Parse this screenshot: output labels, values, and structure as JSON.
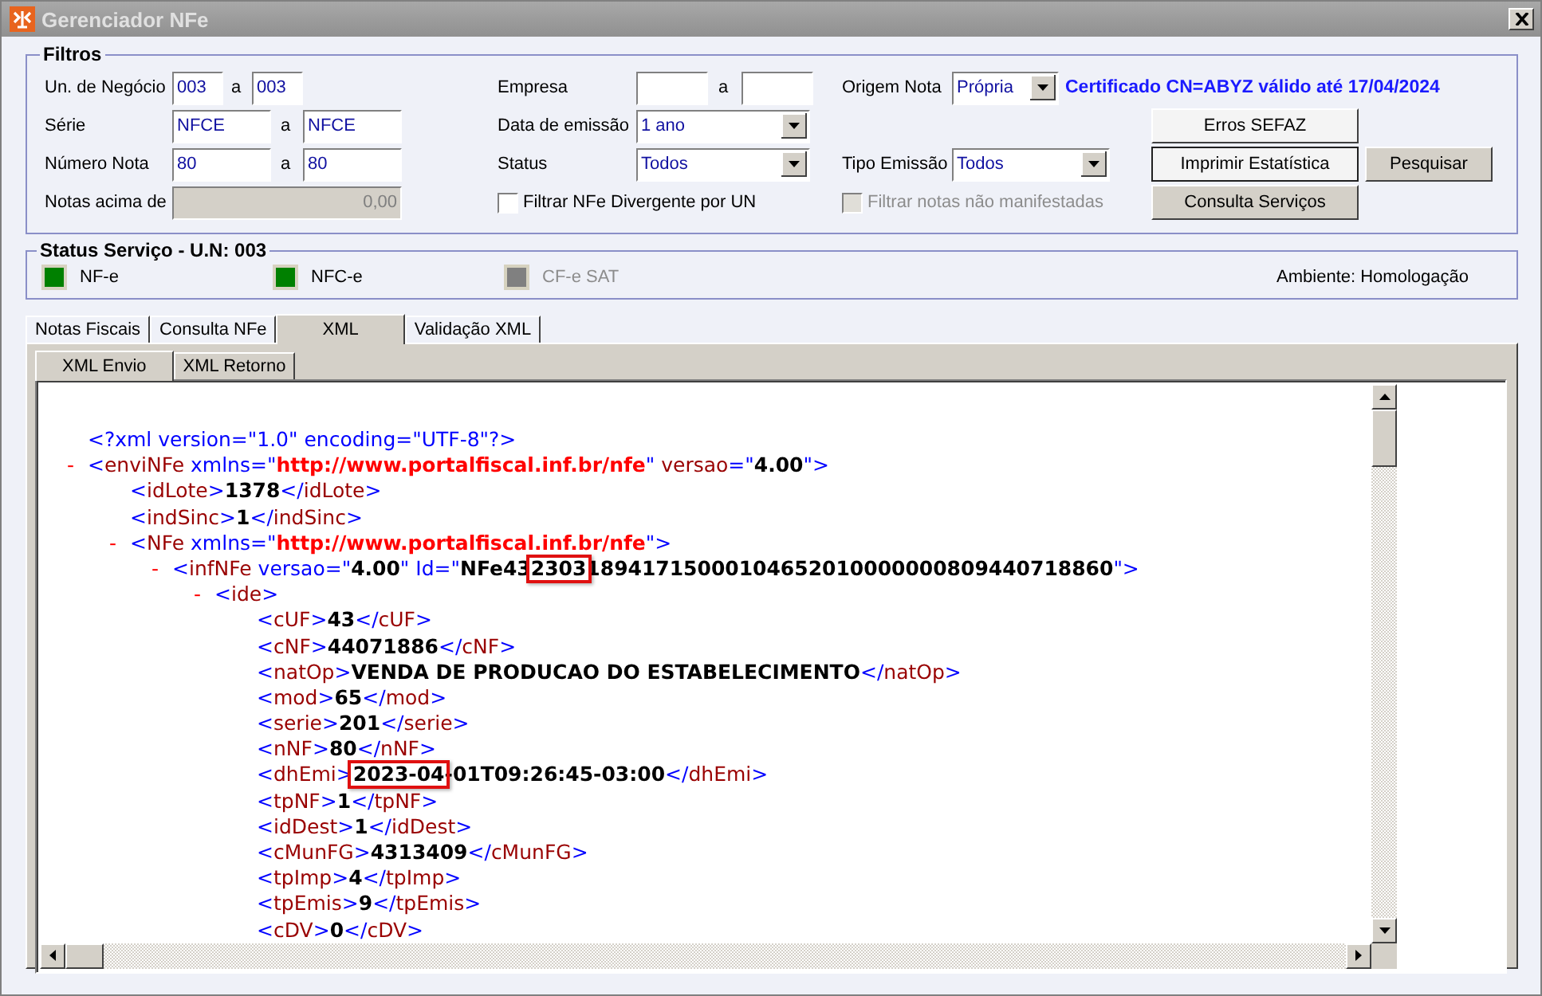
{
  "window": {
    "title": "Gerenciador NFe"
  },
  "filters": {
    "legend": "Filtros",
    "rows": [
      [
        {
          "kind": "range",
          "label": "Un. de Negócio",
          "from": "003",
          "sep": "a",
          "to": "003"
        },
        {
          "kind": "range",
          "label": "Empresa",
          "sep": "a"
        },
        {
          "kind": "select",
          "label": "Origem Nota",
          "value": "Própria",
          "note": "Certificado CN=ABYZ válido até 17/04/2024"
        }
      ],
      [
        {
          "kind": "range",
          "label": "Série",
          "from": "NFCE",
          "sep": "a",
          "to": "NFCE"
        },
        {
          "kind": "select",
          "label": "Data de emissão",
          "value": "1 ano"
        }
      ],
      [
        {
          "kind": "range",
          "label": "Número Nota",
          "from": "80",
          "sep": "a",
          "to": "80"
        },
        {
          "kind": "select",
          "label": "Status",
          "value": "Todos"
        },
        {
          "kind": "select",
          "label": "Tipo Emissão",
          "value": "Todos"
        }
      ],
      [
        {
          "kind": "input",
          "label": "Notas acima de",
          "value": "0,00",
          "disabled": true
        },
        {
          "kind": "checkbox",
          "label": "Filtrar NFe Divergente por UN",
          "checked": false,
          "disabled": false
        },
        {
          "kind": "checkbox",
          "label": "Filtrar notas não manifestadas",
          "checked": false,
          "disabled": true
        }
      ]
    ],
    "buttons": [
      {
        "label": "Erros SEFAZ",
        "highlighted": true
      },
      {
        "label": "Imprimir Estatística",
        "highlighted": true
      },
      {
        "label": "Consulta Serviços",
        "highlighted": false
      },
      {
        "label": "Pesquisar",
        "highlighted": false
      }
    ]
  },
  "status": {
    "legend": "Status Serviço - U.N: 003",
    "items": [
      {
        "label": "NF-e",
        "color": "#008000",
        "enabled": true
      },
      {
        "label": "NFC-e",
        "color": "#008000",
        "enabled": true
      },
      {
        "label": "CF-e SAT",
        "color": "#808080",
        "enabled": false
      }
    ],
    "environment": "Ambiente: Homologação"
  },
  "tabs": [
    {
      "label": "Notas Fiscais",
      "selected": false
    },
    {
      "label": "Consulta NFe",
      "selected": false
    },
    {
      "label": "XML",
      "selected": true
    },
    {
      "label": "Validação XML",
      "selected": false
    }
  ],
  "subtabs": [
    {
      "label": "XML Envio",
      "selected": true
    },
    {
      "label": "XML Retorno",
      "selected": false
    }
  ],
  "xml": [
    {
      "segs": [
        {
          "kind": "punct",
          "text": "<?xml version=\"1.0\" encoding=\"UTF-8\"?>"
        }
      ]
    },
    {
      "toggle": "-",
      "expanded": true,
      "segs": [
        {
          "kind": "punct",
          "text": "<"
        },
        {
          "kind": "tag",
          "text": "enviNFe"
        },
        {
          "kind": "punct",
          "text": " xmlns=\""
        },
        {
          "kind": "url",
          "text": "http://www.portalfiscal.inf.br/nfe"
        },
        {
          "kind": "punct",
          "text": "\""
        },
        {
          "kind": "attr",
          "text": " versao"
        },
        {
          "kind": "punct",
          "text": "=\""
        },
        {
          "kind": "value",
          "text": "4.00"
        },
        {
          "kind": "punct",
          "text": "\">"
        }
      ],
      "children": [
        {
          "segs": [
            {
              "kind": "punct",
              "text": "<"
            },
            {
              "kind": "tag",
              "text": "idLote"
            },
            {
              "kind": "punct",
              "text": ">"
            },
            {
              "kind": "value",
              "text": "1378"
            },
            {
              "kind": "punct",
              "text": "</"
            },
            {
              "kind": "tag",
              "text": "idLote"
            },
            {
              "kind": "punct",
              "text": ">"
            }
          ]
        },
        {
          "segs": [
            {
              "kind": "punct",
              "text": "<"
            },
            {
              "kind": "tag",
              "text": "indSinc"
            },
            {
              "kind": "punct",
              "text": ">"
            },
            {
              "kind": "value",
              "text": "1"
            },
            {
              "kind": "punct",
              "text": "</"
            },
            {
              "kind": "tag",
              "text": "indSinc"
            },
            {
              "kind": "punct",
              "text": ">"
            }
          ]
        },
        {
          "toggle": "-",
          "expanded": true,
          "segs": [
            {
              "kind": "punct",
              "text": "<"
            },
            {
              "kind": "tag",
              "text": "NFe"
            },
            {
              "kind": "punct",
              "text": " xmlns=\""
            },
            {
              "kind": "url",
              "text": "http://www.portalfiscal.inf.br/nfe"
            },
            {
              "kind": "punct",
              "text": "\">"
            }
          ],
          "children": [
            {
              "toggle": "-",
              "expanded": true,
              "segs": [
                {
                  "kind": "punct",
                  "text": "<"
                },
                {
                  "kind": "tag",
                  "text": "infNFe"
                },
                {
                  "kind": "punct",
                  "text": " versao=\""
                },
                {
                  "kind": "value",
                  "text": "4.00"
                },
                {
                  "kind": "punct",
                  "text": "\" Id=\""
                },
                {
                  "kind": "value",
                  "text": "NFe43"
                },
                {
                  "kind": "mark",
                  "text": "2303"
                },
                {
                  "kind": "value",
                  "text": "18941715000104652010000000809440718860"
                },
                {
                  "kind": "punct",
                  "text": "\">"
                }
              ],
              "children": [
                {
                  "toggle": "-",
                  "expanded": true,
                  "segs": [
                    {
                      "kind": "punct",
                      "text": "<"
                    },
                    {
                      "kind": "tag",
                      "text": "ide"
                    },
                    {
                      "kind": "punct",
                      "text": ">"
                    }
                  ],
                  "children": [
                    {
                      "segs": [
                        {
                          "kind": "punct",
                          "text": "<"
                        },
                        {
                          "kind": "tag",
                          "text": "cUF"
                        },
                        {
                          "kind": "punct",
                          "text": ">"
                        },
                        {
                          "kind": "value",
                          "text": "43"
                        },
                        {
                          "kind": "punct",
                          "text": "</"
                        },
                        {
                          "kind": "tag",
                          "text": "cUF"
                        },
                        {
                          "kind": "punct",
                          "text": ">"
                        }
                      ]
                    },
                    {
                      "segs": [
                        {
                          "kind": "punct",
                          "text": "<"
                        },
                        {
                          "kind": "tag",
                          "text": "cNF"
                        },
                        {
                          "kind": "punct",
                          "text": ">"
                        },
                        {
                          "kind": "value",
                          "text": "44071886"
                        },
                        {
                          "kind": "punct",
                          "text": "</"
                        },
                        {
                          "kind": "tag",
                          "text": "cNF"
                        },
                        {
                          "kind": "punct",
                          "text": ">"
                        }
                      ]
                    },
                    {
                      "segs": [
                        {
                          "kind": "punct",
                          "text": "<"
                        },
                        {
                          "kind": "tag",
                          "text": "natOp"
                        },
                        {
                          "kind": "punct",
                          "text": ">"
                        },
                        {
                          "kind": "value",
                          "text": "VENDA DE PRODUCAO DO ESTABELECIMENTO"
                        },
                        {
                          "kind": "punct",
                          "text": "</"
                        },
                        {
                          "kind": "tag",
                          "text": "natOp"
                        },
                        {
                          "kind": "punct",
                          "text": ">"
                        }
                      ]
                    },
                    {
                      "segs": [
                        {
                          "kind": "punct",
                          "text": "<"
                        },
                        {
                          "kind": "tag",
                          "text": "mod"
                        },
                        {
                          "kind": "punct",
                          "text": ">"
                        },
                        {
                          "kind": "value",
                          "text": "65"
                        },
                        {
                          "kind": "punct",
                          "text": "</"
                        },
                        {
                          "kind": "tag",
                          "text": "mod"
                        },
                        {
                          "kind": "punct",
                          "text": ">"
                        }
                      ]
                    },
                    {
                      "segs": [
                        {
                          "kind": "punct",
                          "text": "<"
                        },
                        {
                          "kind": "tag",
                          "text": "serie"
                        },
                        {
                          "kind": "punct",
                          "text": ">"
                        },
                        {
                          "kind": "value",
                          "text": "201"
                        },
                        {
                          "kind": "punct",
                          "text": "</"
                        },
                        {
                          "kind": "tag",
                          "text": "serie"
                        },
                        {
                          "kind": "punct",
                          "text": ">"
                        }
                      ]
                    },
                    {
                      "segs": [
                        {
                          "kind": "punct",
                          "text": "<"
                        },
                        {
                          "kind": "tag",
                          "text": "nNF"
                        },
                        {
                          "kind": "punct",
                          "text": ">"
                        },
                        {
                          "kind": "value",
                          "text": "80"
                        },
                        {
                          "kind": "punct",
                          "text": "</"
                        },
                        {
                          "kind": "tag",
                          "text": "nNF"
                        },
                        {
                          "kind": "punct",
                          "text": ">"
                        }
                      ]
                    },
                    {
                      "segs": [
                        {
                          "kind": "punct",
                          "text": "<"
                        },
                        {
                          "kind": "tag",
                          "text": "dhEmi"
                        },
                        {
                          "kind": "punct",
                          "text": ">"
                        },
                        {
                          "kind": "mark",
                          "text": "2023-04"
                        },
                        {
                          "kind": "value",
                          "text": "-01T09:26:45-03:00"
                        },
                        {
                          "kind": "punct",
                          "text": "</"
                        },
                        {
                          "kind": "tag",
                          "text": "dhEmi"
                        },
                        {
                          "kind": "punct",
                          "text": ">"
                        }
                      ]
                    },
                    {
                      "segs": [
                        {
                          "kind": "punct",
                          "text": "<"
                        },
                        {
                          "kind": "tag",
                          "text": "tpNF"
                        },
                        {
                          "kind": "punct",
                          "text": ">"
                        },
                        {
                          "kind": "value",
                          "text": "1"
                        },
                        {
                          "kind": "punct",
                          "text": "</"
                        },
                        {
                          "kind": "tag",
                          "text": "tpNF"
                        },
                        {
                          "kind": "punct",
                          "text": ">"
                        }
                      ]
                    },
                    {
                      "segs": [
                        {
                          "kind": "punct",
                          "text": "<"
                        },
                        {
                          "kind": "tag",
                          "text": "idDest"
                        },
                        {
                          "kind": "punct",
                          "text": ">"
                        },
                        {
                          "kind": "value",
                          "text": "1"
                        },
                        {
                          "kind": "punct",
                          "text": "</"
                        },
                        {
                          "kind": "tag",
                          "text": "idDest"
                        },
                        {
                          "kind": "punct",
                          "text": ">"
                        }
                      ]
                    },
                    {
                      "segs": [
                        {
                          "kind": "punct",
                          "text": "<"
                        },
                        {
                          "kind": "tag",
                          "text": "cMunFG"
                        },
                        {
                          "kind": "punct",
                          "text": ">"
                        },
                        {
                          "kind": "value",
                          "text": "4313409"
                        },
                        {
                          "kind": "punct",
                          "text": "</"
                        },
                        {
                          "kind": "tag",
                          "text": "cMunFG"
                        },
                        {
                          "kind": "punct",
                          "text": ">"
                        }
                      ]
                    },
                    {
                      "segs": [
                        {
                          "kind": "punct",
                          "text": "<"
                        },
                        {
                          "kind": "tag",
                          "text": "tpImp"
                        },
                        {
                          "kind": "punct",
                          "text": ">"
                        },
                        {
                          "kind": "value",
                          "text": "4"
                        },
                        {
                          "kind": "punct",
                          "text": "</"
                        },
                        {
                          "kind": "tag",
                          "text": "tpImp"
                        },
                        {
                          "kind": "punct",
                          "text": ">"
                        }
                      ]
                    },
                    {
                      "segs": [
                        {
                          "kind": "punct",
                          "text": "<"
                        },
                        {
                          "kind": "tag",
                          "text": "tpEmis"
                        },
                        {
                          "kind": "punct",
                          "text": ">"
                        },
                        {
                          "kind": "value",
                          "text": "9"
                        },
                        {
                          "kind": "punct",
                          "text": "</"
                        },
                        {
                          "kind": "tag",
                          "text": "tpEmis"
                        },
                        {
                          "kind": "punct",
                          "text": ">"
                        }
                      ]
                    },
                    {
                      "segs": [
                        {
                          "kind": "punct",
                          "text": "<"
                        },
                        {
                          "kind": "tag",
                          "text": "cDV"
                        },
                        {
                          "kind": "punct",
                          "text": ">"
                        },
                        {
                          "kind": "value",
                          "text": "0"
                        },
                        {
                          "kind": "punct",
                          "text": "</"
                        },
                        {
                          "kind": "tag",
                          "text": "cDV"
                        },
                        {
                          "kind": "punct",
                          "text": ">"
                        }
                      ]
                    }
                  ]
                }
              ]
            }
          ]
        }
      ]
    }
  ]
}
